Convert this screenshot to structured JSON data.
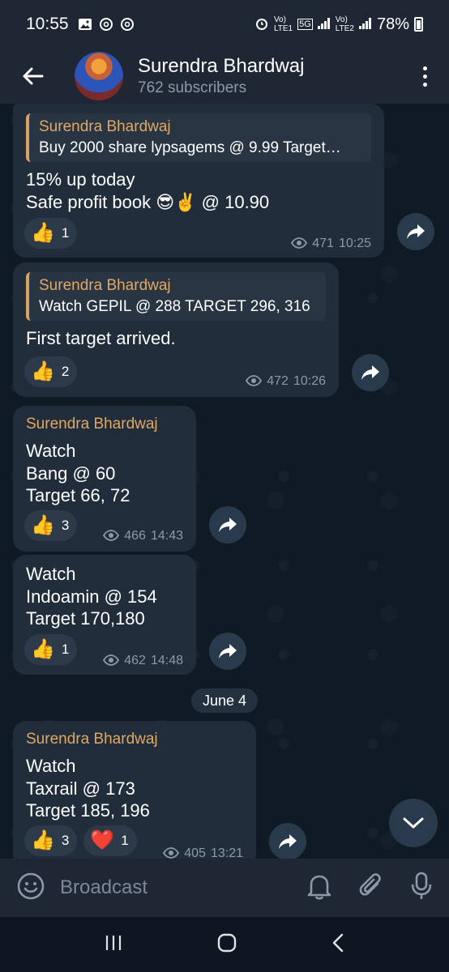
{
  "status_bar": {
    "time": "10:55",
    "network_left": "Vo)",
    "network_left_sub": "LTE1",
    "network_5g": "5G",
    "network_right": "Vo)",
    "network_right_sub": "LTE2",
    "battery": "78%"
  },
  "header": {
    "channel_name": "Surendra Bhardwaj",
    "subscribers": "762 subscribers"
  },
  "messages": [
    {
      "reply_name": "Surendra Bhardwaj",
      "reply_text": "Buy 2000 share  lypsagems @ 9.99  Target…",
      "lines": [
        "15% up today",
        "Safe profit book 😎✌️  @ 10.90"
      ],
      "reaction_emoji": "👍",
      "reaction_count": "1",
      "views": "471",
      "time": "10:25"
    },
    {
      "reply_name": "Surendra Bhardwaj",
      "reply_text": "Watch GEPIL @ 288 TARGET 296, 316",
      "lines": [
        "First target arrived."
      ],
      "reaction_emoji": "👍",
      "reaction_count": "2",
      "views": "472",
      "time": "10:26"
    },
    {
      "sender": "Surendra Bhardwaj",
      "lines": [
        "Watch",
        "Bang @ 60",
        "Target 66, 72"
      ],
      "reaction_emoji": "👍",
      "reaction_count": "3",
      "views": "466",
      "time": "14:43"
    },
    {
      "lines": [
        "Watch",
        "Indoamin @ 154",
        "Target 170,180"
      ],
      "reaction_emoji": "👍",
      "reaction_count": "1",
      "views": "462",
      "time": "14:48"
    },
    {
      "sender": "Surendra Bhardwaj",
      "lines": [
        "Watch",
        "Taxrail @ 173",
        "Target 185, 196"
      ],
      "reaction_emoji": "👍",
      "reaction_count": "3",
      "reaction2_emoji": "❤️",
      "reaction2_count": "1",
      "views": "405",
      "time": "13:21"
    }
  ],
  "date_separator": "June 4",
  "input": {
    "placeholder": "Broadcast"
  },
  "icons": {
    "back": "arrow-left-icon",
    "menu": "more-vertical-icon",
    "share": "share-forward-icon",
    "emoji": "emoji-icon",
    "bell": "bell-icon",
    "attach": "paperclip-icon",
    "mic": "microphone-icon"
  },
  "colors": {
    "accent_name": "#e0a864",
    "bubble": "#212d3b",
    "header": "#1e2733"
  }
}
